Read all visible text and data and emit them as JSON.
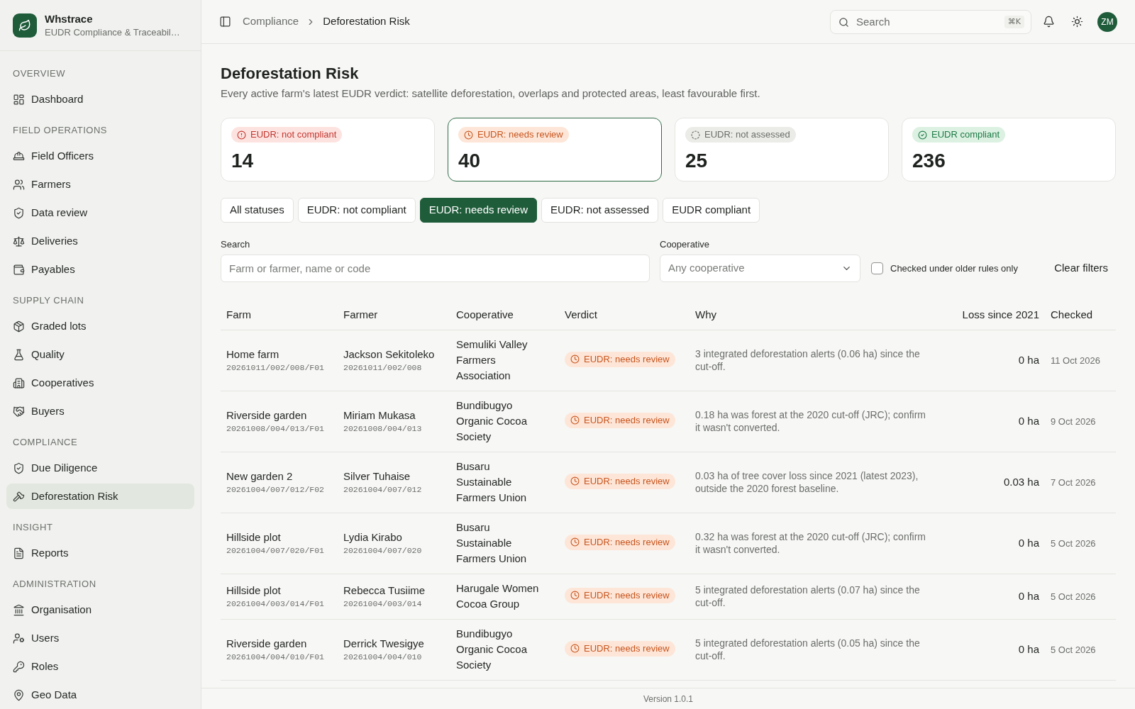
{
  "sidebar": {
    "brand": {
      "name": "Whstrace",
      "subtitle": "EUDR Compliance & Traceabil…"
    },
    "sections": [
      {
        "label": "OVERVIEW",
        "items": [
          {
            "label": "Dashboard",
            "selected": false
          }
        ]
      },
      {
        "label": "FIELD OPERATIONS",
        "items": [
          {
            "label": "Field Officers",
            "selected": false
          },
          {
            "label": "Farmers",
            "selected": false
          },
          {
            "label": "Data review",
            "selected": false
          },
          {
            "label": "Deliveries",
            "selected": false
          },
          {
            "label": "Payables",
            "selected": false
          }
        ]
      },
      {
        "label": "SUPPLY CHAIN",
        "items": [
          {
            "label": "Graded lots",
            "selected": false
          },
          {
            "label": "Quality",
            "selected": false
          },
          {
            "label": "Cooperatives",
            "selected": false
          },
          {
            "label": "Buyers",
            "selected": false
          }
        ]
      },
      {
        "label": "COMPLIANCE",
        "items": [
          {
            "label": "Due Diligence",
            "selected": false
          },
          {
            "label": "Deforestation Risk",
            "selected": true
          }
        ]
      },
      {
        "label": "INSIGHT",
        "items": [
          {
            "label": "Reports",
            "selected": false
          }
        ]
      },
      {
        "label": "ADMINISTRATION",
        "items": [
          {
            "label": "Organisation",
            "selected": false
          },
          {
            "label": "Users",
            "selected": false
          },
          {
            "label": "Roles",
            "selected": false
          },
          {
            "label": "Geo Data",
            "selected": false
          }
        ]
      }
    ]
  },
  "header": {
    "breadcrumbs": [
      "Compliance",
      "Deforestation Risk"
    ],
    "search": {
      "placeholder": "Search",
      "shortcut": "⌘K"
    },
    "avatar": "ZM"
  },
  "page": {
    "title": "Deforestation Risk",
    "subtitle": "Every active farm's latest EUDR verdict: satellite deforestation, overlaps and protected areas, least favourable first."
  },
  "stat_cards": [
    {
      "kind": "not_compliant",
      "label": "EUDR: not compliant",
      "count": "14",
      "selected": false
    },
    {
      "kind": "needs_review",
      "label": "EUDR: needs review",
      "count": "40",
      "selected": true
    },
    {
      "kind": "not_assessed",
      "label": "EUDR: not assessed",
      "count": "25",
      "selected": false
    },
    {
      "kind": "compliant",
      "label": "EUDR compliant",
      "count": "236",
      "selected": false
    }
  ],
  "filter_chips": [
    {
      "label": "All statuses",
      "selected": false
    },
    {
      "label": "EUDR: not compliant",
      "selected": false
    },
    {
      "label": "EUDR: needs review",
      "selected": true
    },
    {
      "label": "EUDR: not assessed",
      "selected": false
    },
    {
      "label": "EUDR compliant",
      "selected": false
    }
  ],
  "filters": {
    "search": {
      "label": "Search",
      "placeholder": "Farm or farmer, name or code"
    },
    "cooperative": {
      "label": "Cooperative",
      "placeholder": "Any cooperative"
    },
    "older_rules": {
      "label": "Checked under older rules only",
      "checked": false
    },
    "clear": "Clear filters"
  },
  "table": {
    "columns": [
      "Farm",
      "Farmer",
      "Cooperative",
      "Verdict",
      "Why",
      "Loss since 2021",
      "Checked"
    ],
    "rows": [
      {
        "farm": "Home farm",
        "farm_code": "20261011/002/008/F01",
        "farmer": "Jackson Sekitoleko",
        "farmer_code": "20261011/002/008",
        "cooperative": "Semuliki Valley Farmers Association",
        "verdict": {
          "kind": "needs_review",
          "label": "EUDR: needs review"
        },
        "why": "3 integrated deforestation alerts (0.06 ha) since the cut-off.",
        "loss": "0 ha",
        "checked": "11 Oct 2026"
      },
      {
        "farm": "Riverside garden",
        "farm_code": "20261008/004/013/F01",
        "farmer": "Miriam Mukasa",
        "farmer_code": "20261008/004/013",
        "cooperative": "Bundibugyo Organic Cocoa Society",
        "verdict": {
          "kind": "needs_review",
          "label": "EUDR: needs review"
        },
        "why": "0.18 ha was forest at the 2020 cut-off (JRC); confirm it wasn't converted.",
        "loss": "0 ha",
        "checked": "9 Oct 2026"
      },
      {
        "farm": "New garden 2",
        "farm_code": "20261004/007/012/F02",
        "farmer": "Silver Tuhaise",
        "farmer_code": "20261004/007/012",
        "cooperative": "Busaru Sustainable Farmers Union",
        "verdict": {
          "kind": "needs_review",
          "label": "EUDR: needs review"
        },
        "why": "0.03 ha of tree cover loss since 2021 (latest 2023), outside the 2020 forest baseline.",
        "loss": "0.03 ha",
        "checked": "7 Oct 2026"
      },
      {
        "farm": "Hillside plot",
        "farm_code": "20261004/007/020/F01",
        "farmer": "Lydia Kirabo",
        "farmer_code": "20261004/007/020",
        "cooperative": "Busaru Sustainable Farmers Union",
        "verdict": {
          "kind": "needs_review",
          "label": "EUDR: needs review"
        },
        "why": "0.32 ha was forest at the 2020 cut-off (JRC); confirm it wasn't converted.",
        "loss": "0 ha",
        "checked": "5 Oct 2026"
      },
      {
        "farm": "Hillside plot",
        "farm_code": "20261004/003/014/F01",
        "farmer": "Rebecca Tusiime",
        "farmer_code": "20261004/003/014",
        "cooperative": "Harugale Women Cocoa Group",
        "verdict": {
          "kind": "needs_review",
          "label": "EUDR: needs review"
        },
        "why": "5 integrated deforestation alerts (0.07 ha) since the cut-off.",
        "loss": "0 ha",
        "checked": "5 Oct 2026"
      },
      {
        "farm": "Riverside garden",
        "farm_code": "20261004/004/010/F01",
        "farmer": "Derrick Twesigye",
        "farmer_code": "20261004/004/010",
        "cooperative": "Bundibugyo Organic Cocoa Society",
        "verdict": {
          "kind": "needs_review",
          "label": "EUDR: needs review"
        },
        "why": "5 integrated deforestation alerts (0.05 ha) since the cut-off.",
        "loss": "0 ha",
        "checked": "5 Oct 2026"
      }
    ]
  },
  "footer": {
    "version": "Version 1.0.1"
  }
}
